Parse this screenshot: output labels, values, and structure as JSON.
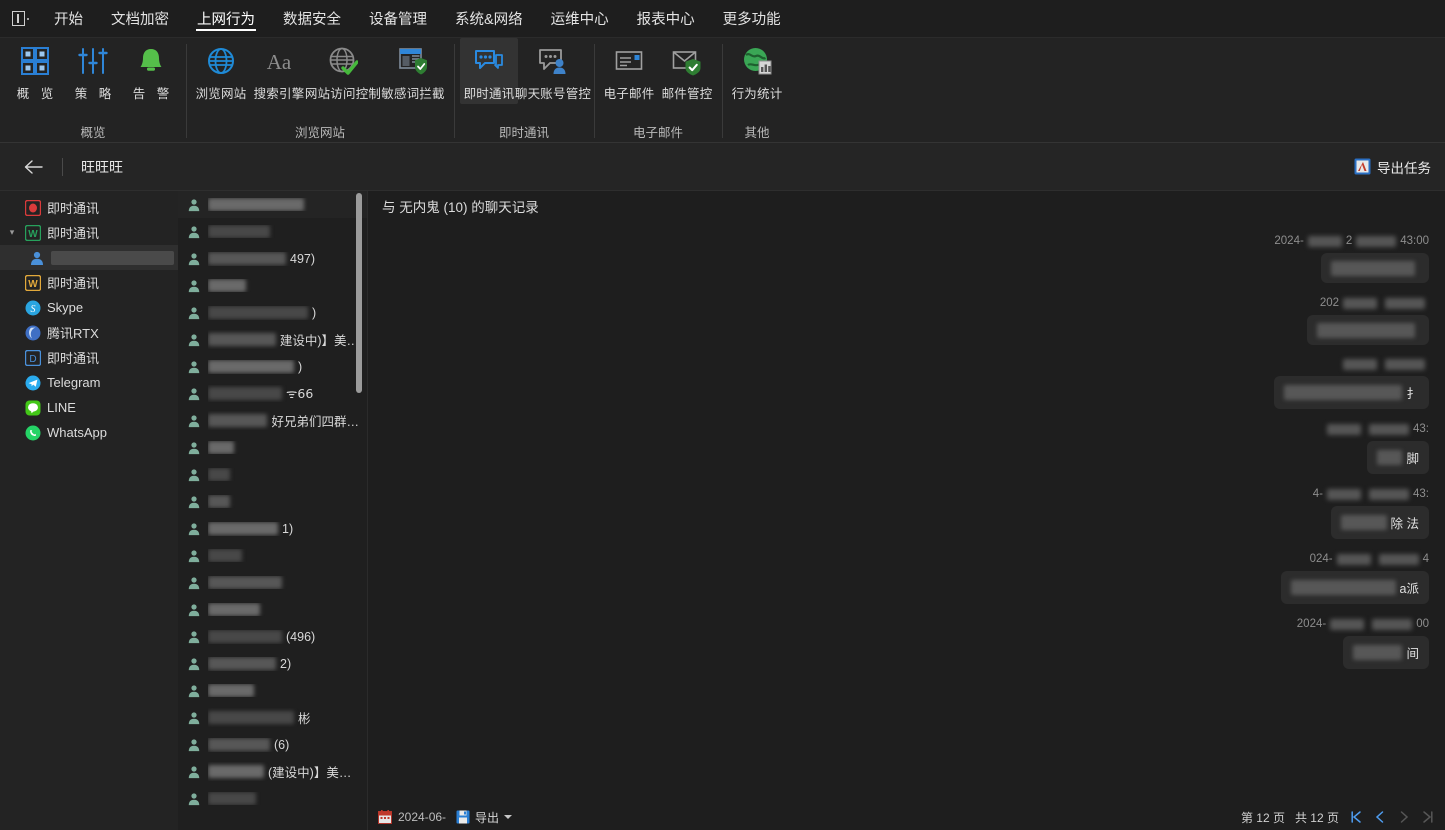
{
  "app": {
    "menu_icon": "app-menu-icon",
    "menu": [
      {
        "label": "开始",
        "active": false
      },
      {
        "label": "文档加密",
        "active": false
      },
      {
        "label": "上网行为",
        "active": true
      },
      {
        "label": "数据安全",
        "active": false
      },
      {
        "label": "设备管理",
        "active": false
      },
      {
        "label": "系统&网络",
        "active": false
      },
      {
        "label": "运维中心",
        "active": false
      },
      {
        "label": "报表中心",
        "active": false
      },
      {
        "label": "更多功能",
        "active": false
      }
    ]
  },
  "ribbon": {
    "groups": [
      {
        "label": "概览",
        "items": [
          {
            "label": "概 览",
            "icon": "grid-blocks-icon",
            "active": false,
            "spaced": true
          },
          {
            "label": "策 略",
            "icon": "sliders-icon",
            "active": false,
            "spaced": true
          },
          {
            "label": "告 警",
            "icon": "bell-icon",
            "active": false,
            "spaced": true
          }
        ]
      },
      {
        "label": "浏览网站",
        "items": [
          {
            "label": "浏览网站",
            "icon": "globe-icon",
            "active": false
          },
          {
            "label": "搜索引擎",
            "icon": "font-aa-icon",
            "active": false
          },
          {
            "label": "网站访问控制",
            "icon": "globe-check-icon",
            "active": false
          },
          {
            "label": "敏感词拦截",
            "icon": "browser-shield-icon",
            "active": false
          }
        ]
      },
      {
        "label": "即时通讯",
        "items": [
          {
            "label": "即时通讯",
            "icon": "chat-bubbles-icon",
            "active": true
          },
          {
            "label": "聊天账号管控",
            "icon": "chat-user-icon",
            "active": false
          }
        ]
      },
      {
        "label": "电子邮件",
        "items": [
          {
            "label": "电子邮件",
            "icon": "mail-card-icon",
            "active": false
          },
          {
            "label": "邮件管控",
            "icon": "mail-shield-icon",
            "active": false
          }
        ]
      },
      {
        "label": "其他",
        "items": [
          {
            "label": "行为统计",
            "icon": "globe-chart-icon",
            "active": false
          }
        ]
      }
    ]
  },
  "subheader": {
    "back_icon": "back-arrow-icon",
    "title": "旺旺旺",
    "export_task_label": "导出任务",
    "export_task_icon": "export-task-icon"
  },
  "tree": {
    "items": [
      {
        "label": "即时通讯",
        "icon": "qq-icon",
        "icon_color": "#d93b3b",
        "indent": 0,
        "chevron": "",
        "selected": false,
        "redacted": false
      },
      {
        "label": "即时通讯",
        "icon": "wechat-work-icon",
        "icon_color": "#27a15c",
        "indent": 0,
        "chevron": "▾",
        "selected": false,
        "redacted": false
      },
      {
        "label": "",
        "icon": "user-icon",
        "icon_color": "#4a90d9",
        "indent": 1,
        "chevron": "",
        "selected": true,
        "redacted": true
      },
      {
        "label": "即时通讯",
        "icon": "wechat-icon",
        "icon_color": "#e2a93b",
        "indent": 0,
        "chevron": "",
        "selected": false,
        "redacted": false
      },
      {
        "label": "Skype",
        "icon": "skype-icon",
        "icon_color": "#2aa5e0",
        "indent": 0,
        "chevron": "",
        "selected": false,
        "redacted": false
      },
      {
        "label": "腾讯RTX",
        "icon": "rtx-icon",
        "icon_color": "#3f6fc4",
        "indent": 0,
        "chevron": "",
        "selected": false,
        "redacted": false
      },
      {
        "label": "即时通讯",
        "icon": "dingtalk-icon",
        "icon_color": "#4a90d9",
        "indent": 0,
        "chevron": "",
        "selected": false,
        "redacted": false
      },
      {
        "label": "Telegram",
        "icon": "telegram-icon",
        "icon_color": "#2aabee",
        "indent": 0,
        "chevron": "",
        "selected": false,
        "redacted": false
      },
      {
        "label": "LINE",
        "icon": "line-icon",
        "icon_color": "#43c718",
        "indent": 0,
        "chevron": "",
        "selected": false,
        "redacted": false
      },
      {
        "label": "WhatsApp",
        "icon": "whatsapp-icon",
        "icon_color": "#25d366",
        "indent": 0,
        "chevron": "",
        "selected": false,
        "redacted": false
      }
    ]
  },
  "contacts": {
    "scrollbar": "contacts-scrollbar",
    "rows": [
      {
        "icon": "contact-group-icon",
        "redact": [
          96,
          0
        ],
        "text": "",
        "alt": true
      },
      {
        "icon": "contact-group-icon",
        "redact": [
          62,
          0
        ],
        "text": "",
        "alt": false
      },
      {
        "icon": "contact-group-icon",
        "redact": [
          78,
          0
        ],
        "text": "497)",
        "alt": false
      },
      {
        "icon": "contact-group-icon",
        "redact": [
          38,
          0
        ],
        "text": "",
        "alt": false
      },
      {
        "icon": "contact-group-icon",
        "redact": [
          100,
          0
        ],
        "text": ")",
        "alt": false
      },
      {
        "icon": "contact-group-icon",
        "redact": [
          70,
          0
        ],
        "text": "建设中)】美…",
        "alt": false
      },
      {
        "icon": "contact-group-icon",
        "redact": [
          86,
          0
        ],
        "text": ")",
        "alt": false
      },
      {
        "icon": "contact-group-icon",
        "redact": [
          74,
          0
        ],
        "text": "ᯤ𝟨𝟨",
        "alt": false
      },
      {
        "icon": "contact-group-icon",
        "redact": [
          66,
          0
        ],
        "text": "好兄弟们四群…",
        "alt": false
      },
      {
        "icon": "contact-group-icon",
        "redact": [
          26,
          0
        ],
        "text": "",
        "alt": false
      },
      {
        "icon": "contact-group-icon",
        "redact": [
          22,
          0
        ],
        "text": "",
        "alt": false
      },
      {
        "icon": "contact-group-icon",
        "redact": [
          22,
          0
        ],
        "text": "",
        "alt": false
      },
      {
        "icon": "contact-group-icon",
        "redact": [
          70,
          0
        ],
        "text": "1)",
        "alt": false
      },
      {
        "icon": "contact-group-icon",
        "redact": [
          34,
          0
        ],
        "text": "",
        "alt": false
      },
      {
        "icon": "contact-group-icon",
        "redact": [
          74,
          0
        ],
        "text": "",
        "alt": false
      },
      {
        "icon": "contact-group-icon",
        "redact": [
          52,
          0
        ],
        "text": "",
        "alt": false
      },
      {
        "icon": "contact-group-icon",
        "redact": [
          74,
          0
        ],
        "text": "(496)",
        "alt": false
      },
      {
        "icon": "contact-group-icon",
        "redact": [
          68,
          0
        ],
        "text": "2)",
        "alt": false
      },
      {
        "icon": "contact-group-icon",
        "redact": [
          46,
          0
        ],
        "text": "",
        "alt": false
      },
      {
        "icon": "contact-group-icon",
        "redact": [
          86,
          0
        ],
        "text": "彬",
        "alt": false
      },
      {
        "icon": "contact-group-icon",
        "redact": [
          62,
          0
        ],
        "text": "(6)",
        "alt": false
      },
      {
        "icon": "contact-group-icon",
        "redact": [
          56,
          0
        ],
        "text": "(建设中)】美…",
        "alt": false
      },
      {
        "icon": "contact-group-icon",
        "redact": [
          48,
          0
        ],
        "text": "",
        "alt": false
      }
    ]
  },
  "chat": {
    "header": "与 无内鬼 (10) 的聊天记录",
    "messages": [
      {
        "date_prefix": "2024-",
        "date_mid": "2",
        "time_suffix": "43:00",
        "text": "",
        "bubble_w": 108
      },
      {
        "date_prefix": "202",
        "date_mid": "",
        "time_suffix": "",
        "text": "",
        "bubble_w": 122
      },
      {
        "date_prefix": "",
        "date_mid": "",
        "time_suffix": "",
        "text": "扌",
        "bubble_w": 155
      },
      {
        "date_prefix": "",
        "date_mid": "",
        "time_suffix": "43:",
        "text": "脚",
        "bubble_w": 62
      },
      {
        "date_prefix": "4-",
        "date_mid": "",
        "time_suffix": "43:",
        "text": "除 法",
        "bubble_w": 98
      },
      {
        "date_prefix": "024-",
        "date_mid": "",
        "time_suffix": "4",
        "text": "a派",
        "bubble_w": 148
      },
      {
        "date_prefix": "2024-",
        "date_mid": "",
        "time_suffix": "00",
        "text": "间",
        "bubble_w": 86
      }
    ],
    "footer": {
      "calendar_icon": "calendar-icon",
      "date": "2024-06-",
      "export_icon": "export-icon",
      "export_label": "导出",
      "page_current": "第 12 页",
      "page_total": "共 12 页",
      "first_icon": "first-page-icon",
      "prev_icon": "prev-page-icon",
      "next_icon": "next-page-icon",
      "last_icon": "last-page-icon"
    }
  },
  "colors": {
    "accent": "#2a7fd4",
    "background": "#1e1e1e",
    "panel": "#232323",
    "green": "#4caf50"
  }
}
